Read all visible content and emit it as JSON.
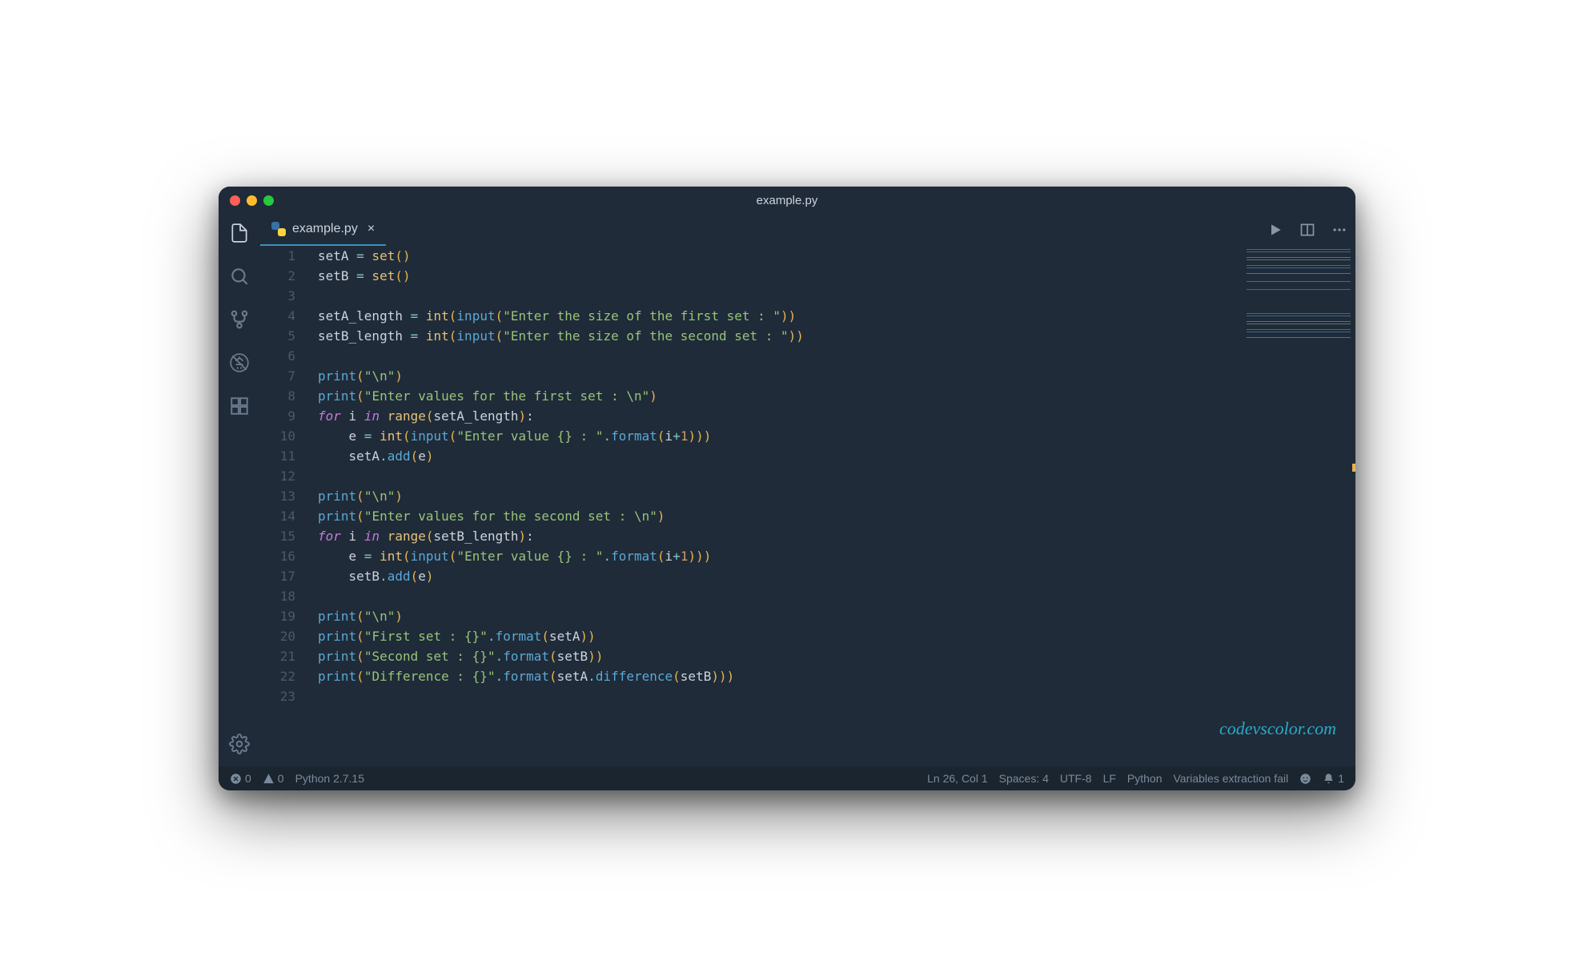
{
  "window": {
    "title": "example.py"
  },
  "tab": {
    "filename": "example.py"
  },
  "watermark": "codevscolor.com",
  "statusbar": {
    "errors": "0",
    "warnings": "0",
    "python_version": "Python 2.7.15",
    "cursor": "Ln 26, Col 1",
    "spaces": "Spaces: 4",
    "encoding": "UTF-8",
    "eol": "LF",
    "language": "Python",
    "variables": "Variables extraction fail",
    "notifications": "1"
  },
  "code_lines": [
    {
      "n": 1,
      "html": "setA <span class='tok-op'>=</span> <span class='tok-builtin'>set</span><span class='tok-paren'>()</span>"
    },
    {
      "n": 2,
      "html": "setB <span class='tok-op'>=</span> <span class='tok-builtin'>set</span><span class='tok-paren'>()</span>"
    },
    {
      "n": 3,
      "html": ""
    },
    {
      "n": 4,
      "html": "setA_length <span class='tok-op'>=</span> <span class='tok-builtin'>int</span><span class='tok-paren'>(</span><span class='tok-func'>input</span><span class='tok-paren'>(</span><span class='tok-str'>\"Enter the size of the first set : \"</span><span class='tok-paren'>))</span>"
    },
    {
      "n": 5,
      "html": "setB_length <span class='tok-op'>=</span> <span class='tok-builtin'>int</span><span class='tok-paren'>(</span><span class='tok-func'>input</span><span class='tok-paren'>(</span><span class='tok-str'>\"Enter the size of the second set : \"</span><span class='tok-paren'>))</span>"
    },
    {
      "n": 6,
      "html": ""
    },
    {
      "n": 7,
      "html": "<span class='tok-func'>print</span><span class='tok-paren'>(</span><span class='tok-str'>\"\\n\"</span><span class='tok-paren'>)</span>"
    },
    {
      "n": 8,
      "html": "<span class='tok-func'>print</span><span class='tok-paren'>(</span><span class='tok-str'>\"Enter values for the first set : \\n\"</span><span class='tok-paren'>)</span>"
    },
    {
      "n": 9,
      "html": "<span class='tok-kw'>for</span> i <span class='tok-kw'>in</span> <span class='tok-builtin'>range</span><span class='tok-paren'>(</span>setA_length<span class='tok-paren'>)</span>:"
    },
    {
      "n": 10,
      "html": "    e <span class='tok-op'>=</span> <span class='tok-builtin'>int</span><span class='tok-paren'>(</span><span class='tok-func'>input</span><span class='tok-paren'>(</span><span class='tok-str'>\"Enter value {} : \"</span><span class='tok-dot'>.</span><span class='tok-func'>format</span><span class='tok-paren'>(</span>i<span class='tok-op'>+</span><span class='tok-num'>1</span><span class='tok-paren'>)))</span>"
    },
    {
      "n": 11,
      "html": "    setA<span class='tok-dot'>.</span><span class='tok-func'>add</span><span class='tok-paren'>(</span>e<span class='tok-paren'>)</span>"
    },
    {
      "n": 12,
      "html": ""
    },
    {
      "n": 13,
      "html": "<span class='tok-func'>print</span><span class='tok-paren'>(</span><span class='tok-str'>\"\\n\"</span><span class='tok-paren'>)</span>"
    },
    {
      "n": 14,
      "html": "<span class='tok-func'>print</span><span class='tok-paren'>(</span><span class='tok-str'>\"Enter values for the second set : \\n\"</span><span class='tok-paren'>)</span>"
    },
    {
      "n": 15,
      "html": "<span class='tok-kw'>for</span> i <span class='tok-kw'>in</span> <span class='tok-builtin'>range</span><span class='tok-paren'>(</span>setB_length<span class='tok-paren'>)</span>:"
    },
    {
      "n": 16,
      "html": "    e <span class='tok-op'>=</span> <span class='tok-builtin'>int</span><span class='tok-paren'>(</span><span class='tok-func'>input</span><span class='tok-paren'>(</span><span class='tok-str'>\"Enter value {} : \"</span><span class='tok-dot'>.</span><span class='tok-func'>format</span><span class='tok-paren'>(</span>i<span class='tok-op'>+</span><span class='tok-num'>1</span><span class='tok-paren'>)))</span>"
    },
    {
      "n": 17,
      "html": "    setB<span class='tok-dot'>.</span><span class='tok-func'>add</span><span class='tok-paren'>(</span>e<span class='tok-paren'>)</span>"
    },
    {
      "n": 18,
      "html": ""
    },
    {
      "n": 19,
      "html": "<span class='tok-func'>print</span><span class='tok-paren'>(</span><span class='tok-str'>\"\\n\"</span><span class='tok-paren'>)</span>"
    },
    {
      "n": 20,
      "html": "<span class='tok-func'>print</span><span class='tok-paren'>(</span><span class='tok-str'>\"First set : {}\"</span><span class='tok-dot'>.</span><span class='tok-func'>format</span><span class='tok-paren'>(</span>setA<span class='tok-paren'>))</span>"
    },
    {
      "n": 21,
      "html": "<span class='tok-func'>print</span><span class='tok-paren'>(</span><span class='tok-str'>\"Second set : {}\"</span><span class='tok-dot'>.</span><span class='tok-func'>format</span><span class='tok-paren'>(</span>setB<span class='tok-paren'>))</span>"
    },
    {
      "n": 22,
      "html": "<span class='tok-func'>print</span><span class='tok-paren'>(</span><span class='tok-str'>\"Difference : {}\"</span><span class='tok-dot'>.</span><span class='tok-func'>format</span><span class='tok-paren'>(</span>setA<span class='tok-dot'>.</span><span class='tok-func'>difference</span><span class='tok-paren'>(</span>setB<span class='tok-paren'>)))</span>"
    },
    {
      "n": 23,
      "html": ""
    }
  ]
}
